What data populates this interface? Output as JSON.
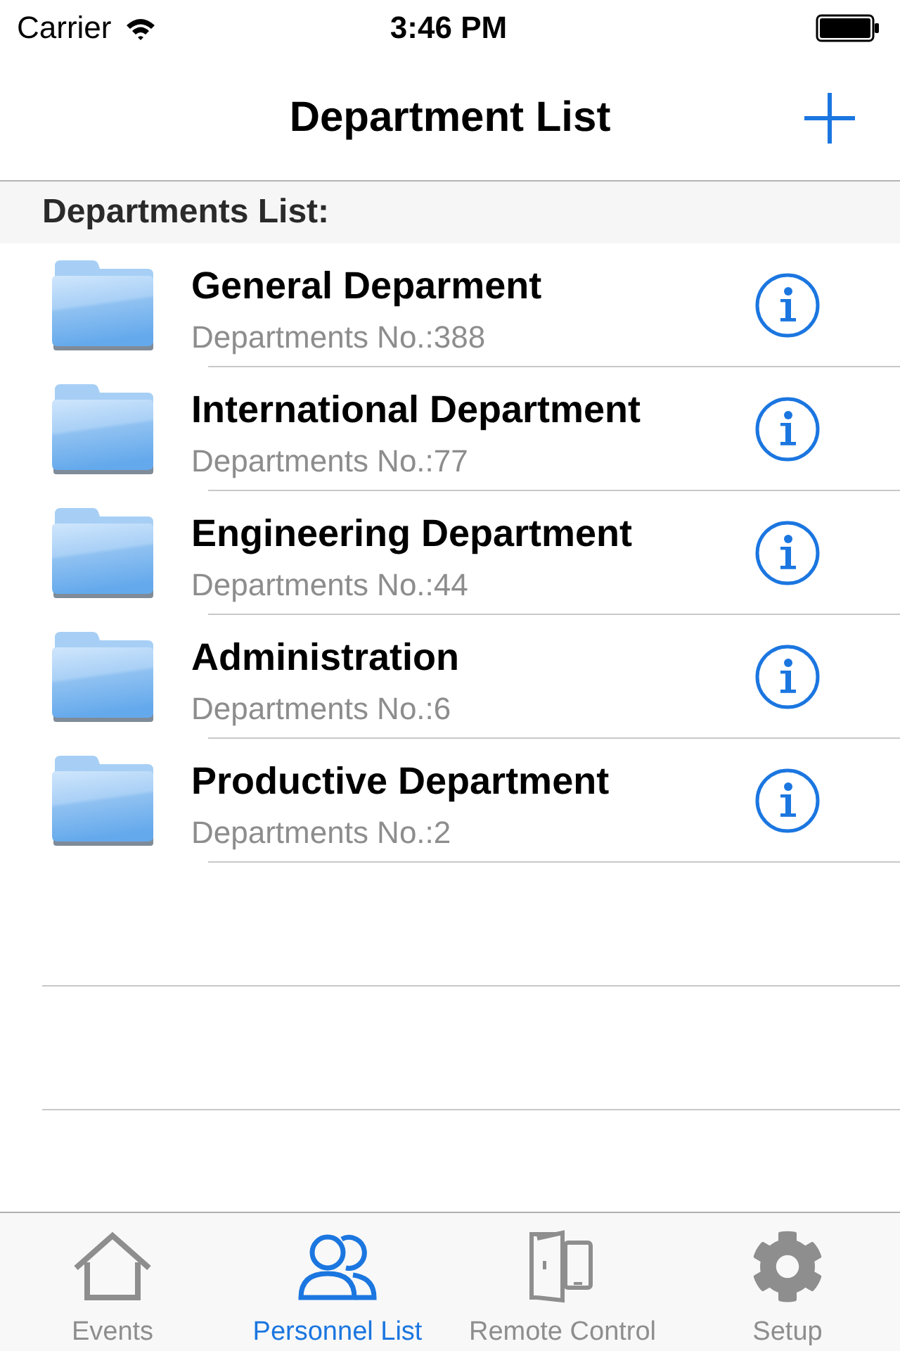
{
  "status_bar": {
    "carrier": "Carrier",
    "time": "3:46 PM"
  },
  "nav_bar": {
    "title": "Department List"
  },
  "section_header": "Departments List:",
  "departments": [
    {
      "name": "General Deparment",
      "count": "Departments No.:388"
    },
    {
      "name": "International Department",
      "count": "Departments No.:77"
    },
    {
      "name": "Engineering Department",
      "count": "Departments No.:44"
    },
    {
      "name": "Administration",
      "count": "Departments No.:6"
    },
    {
      "name": "Productive Department",
      "count": "Departments No.:2"
    }
  ],
  "tab_bar": {
    "tabs": [
      {
        "label": "Events",
        "kind": "home",
        "selected": false
      },
      {
        "label": "Personnel List",
        "kind": "people",
        "selected": true
      },
      {
        "label": "Remote Control",
        "kind": "door",
        "selected": false
      },
      {
        "label": "Setup",
        "kind": "gear",
        "selected": false
      }
    ]
  }
}
